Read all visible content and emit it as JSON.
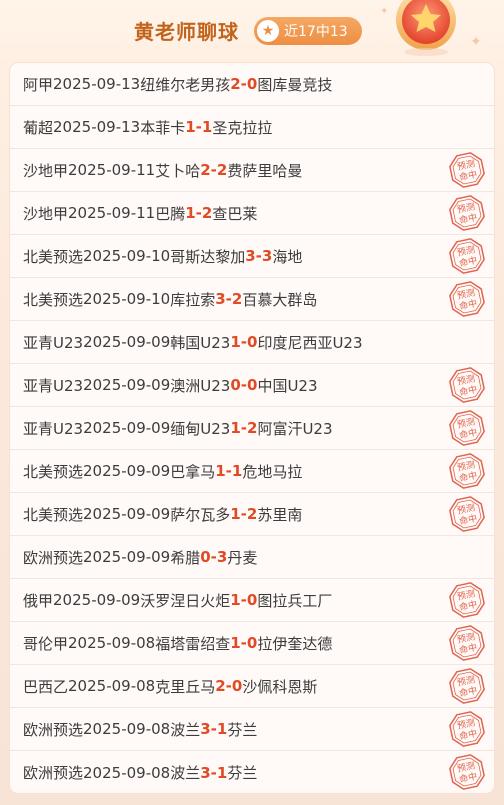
{
  "header": {
    "title": "黄老师聊球",
    "record_badge": "近17中13"
  },
  "stamp_text": [
    "预测",
    "命中"
  ],
  "matches": [
    {
      "league": "阿甲",
      "date": "2025-09-13",
      "home": "纽维尔老男孩",
      "home_score": "2",
      "away_score": "0",
      "away": "图库曼竞技",
      "hit": false
    },
    {
      "league": "葡超",
      "date": "2025-09-13",
      "home": "本菲卡",
      "home_score": "1",
      "away_score": "1",
      "away": "圣克拉拉",
      "hit": false
    },
    {
      "league": "沙地甲",
      "date": "2025-09-11",
      "home": "艾卜哈",
      "home_score": "2",
      "away_score": "2",
      "away": "费萨里哈曼",
      "hit": true
    },
    {
      "league": "沙地甲",
      "date": "2025-09-11",
      "home": "巴腾",
      "home_score": "1",
      "away_score": "2",
      "away": "查巴莱",
      "hit": true
    },
    {
      "league": "北美预选",
      "date": "2025-09-10",
      "home": "哥斯达黎加",
      "home_score": "3",
      "away_score": "3",
      "away": "海地",
      "hit": true
    },
    {
      "league": "北美预选",
      "date": "2025-09-10",
      "home": "库拉索",
      "home_score": "3",
      "away_score": "2",
      "away": "百慕大群岛",
      "hit": true
    },
    {
      "league": "亚青U23",
      "date": "2025-09-09",
      "home": "韩国U23",
      "home_score": "1",
      "away_score": "0",
      "away": "印度尼西亚U23",
      "hit": false
    },
    {
      "league": "亚青U23",
      "date": "2025-09-09",
      "home": "澳洲U23",
      "home_score": "0",
      "away_score": "0",
      "away": "中国U23",
      "hit": true
    },
    {
      "league": "亚青U23",
      "date": "2025-09-09",
      "home": "缅甸U23",
      "home_score": "1",
      "away_score": "2",
      "away": "阿富汗U23",
      "hit": true
    },
    {
      "league": "北美预选",
      "date": "2025-09-09",
      "home": "巴拿马",
      "home_score": "1",
      "away_score": "1",
      "away": "危地马拉",
      "hit": true
    },
    {
      "league": "北美预选",
      "date": "2025-09-09",
      "home": "萨尔瓦多",
      "home_score": "1",
      "away_score": "2",
      "away": "苏里南",
      "hit": true
    },
    {
      "league": "欧洲预选",
      "date": "2025-09-09",
      "home": "希腊",
      "home_score": "0",
      "away_score": "3",
      "away": "丹麦",
      "hit": false
    },
    {
      "league": "俄甲",
      "date": "2025-09-09",
      "home": "沃罗涅日火炬",
      "home_score": "1",
      "away_score": "0",
      "away": "图拉兵工厂",
      "hit": true
    },
    {
      "league": "哥伦甲",
      "date": "2025-09-08",
      "home": "福塔雷绍查",
      "home_score": "1",
      "away_score": "0",
      "away": "拉伊奎达德",
      "hit": true
    },
    {
      "league": "巴西乙",
      "date": "2025-09-08",
      "home": "克里丘马",
      "home_score": "2",
      "away_score": "0",
      "away": "沙佩科恩斯",
      "hit": true
    },
    {
      "league": "欧洲预选",
      "date": "2025-09-08",
      "home": "波兰",
      "home_score": "3",
      "away_score": "1",
      "away": "芬兰",
      "hit": true
    },
    {
      "league": "欧洲预选",
      "date": "2025-09-08",
      "home": "波兰",
      "home_score": "3",
      "away_score": "1",
      "away": "芬兰",
      "hit": true
    }
  ],
  "colors": {
    "title": "#c2641b",
    "badge": "#ee8e43",
    "score": "#e04a25",
    "stamp": "#e0644f"
  }
}
